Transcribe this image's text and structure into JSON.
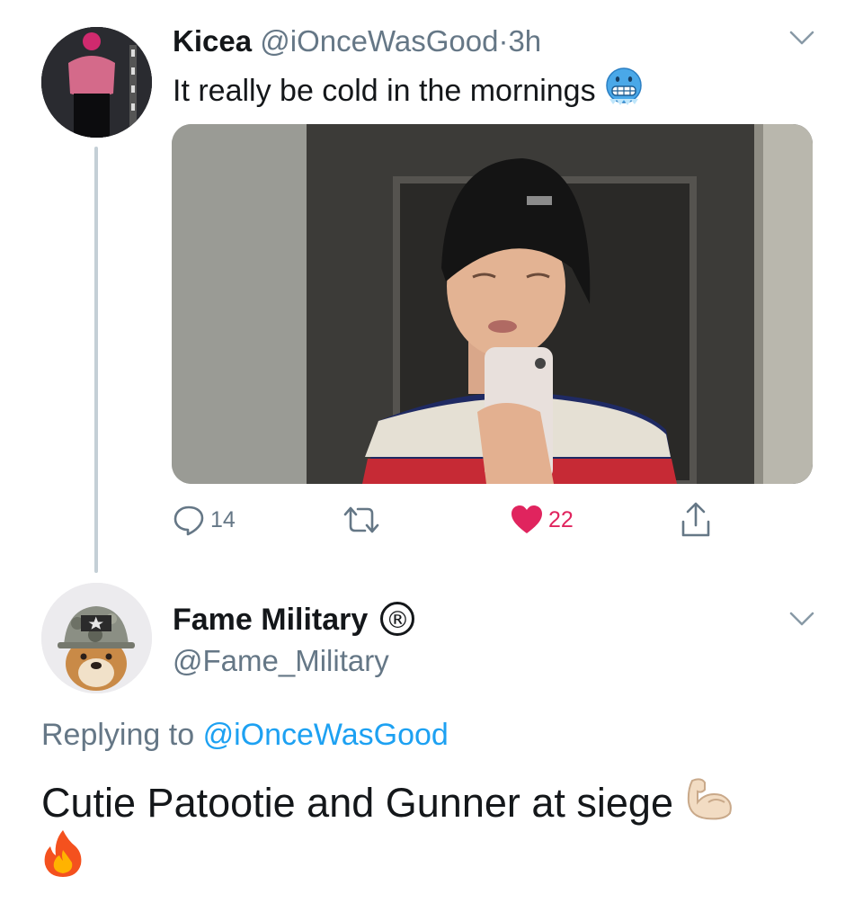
{
  "tweet": {
    "author_name": "Kicea",
    "author_handle": "@iOnceWasGood",
    "separator": "·",
    "time": "3h",
    "text": "It really be cold in the mornings",
    "text_emoji": "cold-face-emoji",
    "actions": {
      "reply_count": "14",
      "retweet_count": "",
      "like_count": "22"
    },
    "colors": {
      "like": "#e0245e",
      "muted": "#657786",
      "link": "#1da1f2"
    }
  },
  "reply": {
    "author_name": "Fame Military",
    "badge": "®",
    "author_handle": "@Fame_Military",
    "replying_label": "Replying to",
    "replying_handle": "@iOnceWasGood",
    "text": "Cutie Patootie and Gunner at siege",
    "text_emojis": [
      "flexed-biceps-emoji",
      "fire-emoji"
    ]
  }
}
